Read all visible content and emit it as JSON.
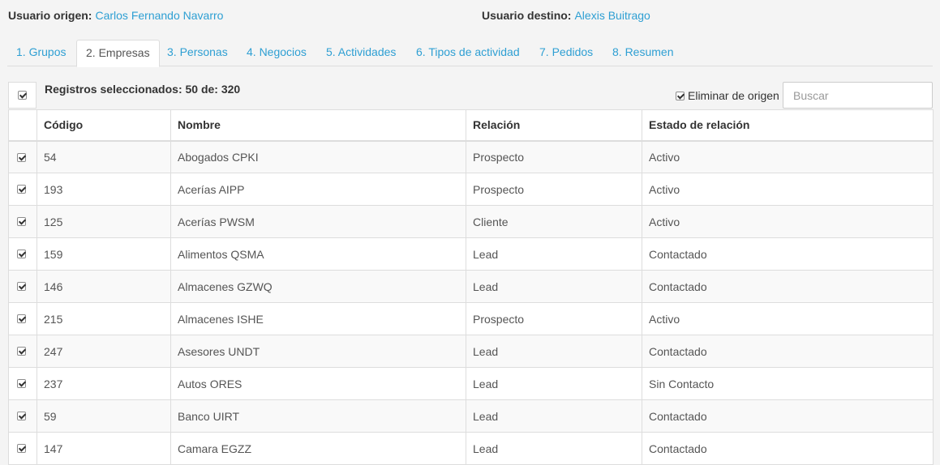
{
  "header": {
    "origin_label": "Usuario origen:",
    "origin_user": "Carlos Fernando Navarro",
    "dest_label": "Usuario destino:",
    "dest_user": "Alexis Buitrago"
  },
  "tabs": [
    {
      "label": "1. Grupos",
      "active": false
    },
    {
      "label": "2. Empresas",
      "active": true
    },
    {
      "label": "3. Personas",
      "active": false
    },
    {
      "label": "4. Negocios",
      "active": false
    },
    {
      "label": "5. Actividades",
      "active": false
    },
    {
      "label": "6. Tipos de actividad",
      "active": false
    },
    {
      "label": "7. Pedidos",
      "active": false
    },
    {
      "label": "8. Resumen",
      "active": false
    }
  ],
  "toolbar": {
    "selected_text": "Registros seleccionados: 50 de: 320",
    "select_all_checked": true,
    "delete_origin_label": "Eliminar de origen",
    "delete_origin_checked": true,
    "search_placeholder": "Buscar",
    "search_value": ""
  },
  "table": {
    "headers": [
      "Código",
      "Nombre",
      "Relación",
      "Estado de relación"
    ],
    "rows": [
      {
        "checked": true,
        "codigo": "54",
        "nombre": "Abogados CPKI",
        "relacion": "Prospecto",
        "estado": "Activo"
      },
      {
        "checked": true,
        "codigo": "193",
        "nombre": "Acerías AIPP",
        "relacion": "Prospecto",
        "estado": "Activo"
      },
      {
        "checked": true,
        "codigo": "125",
        "nombre": "Acerías PWSM",
        "relacion": "Cliente",
        "estado": "Activo"
      },
      {
        "checked": true,
        "codigo": "159",
        "nombre": "Alimentos QSMA",
        "relacion": "Lead",
        "estado": "Contactado"
      },
      {
        "checked": true,
        "codigo": "146",
        "nombre": "Almacenes GZWQ",
        "relacion": "Lead",
        "estado": "Contactado"
      },
      {
        "checked": true,
        "codigo": "215",
        "nombre": "Almacenes ISHE",
        "relacion": "Prospecto",
        "estado": "Activo"
      },
      {
        "checked": true,
        "codigo": "247",
        "nombre": "Asesores UNDT",
        "relacion": "Lead",
        "estado": "Contactado"
      },
      {
        "checked": true,
        "codigo": "237",
        "nombre": "Autos ORES",
        "relacion": "Lead",
        "estado": "Sin Contacto"
      },
      {
        "checked": true,
        "codigo": "59",
        "nombre": "Banco UIRT",
        "relacion": "Lead",
        "estado": "Contactado"
      },
      {
        "checked": true,
        "codigo": "147",
        "nombre": "Camara EGZZ",
        "relacion": "Lead",
        "estado": "Contactado"
      }
    ]
  },
  "colors": {
    "link": "#2e9fd3",
    "border": "#dddddd",
    "page_bg": "#f4f4f4"
  }
}
